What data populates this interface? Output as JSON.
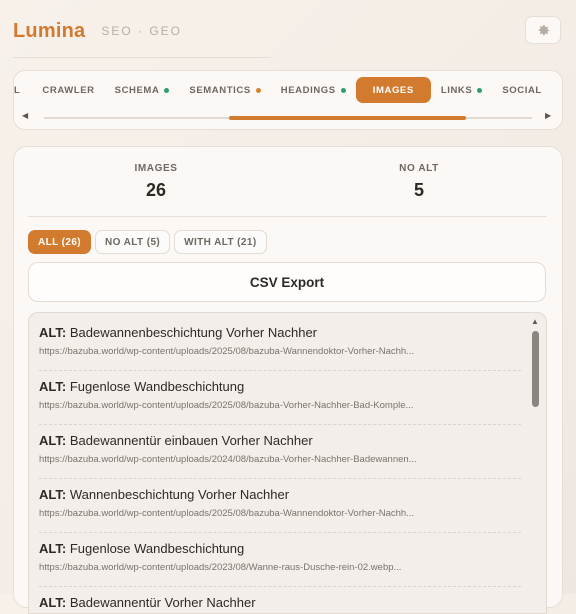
{
  "app": {
    "brand": "Lumina",
    "tagline": "SEO · GEO",
    "settings_icon": "gear-icon"
  },
  "tabs": [
    {
      "label": "L",
      "dot": null,
      "active": false
    },
    {
      "label": "CRAWLER",
      "dot": null,
      "active": false
    },
    {
      "label": "SCHEMA",
      "dot": "#2f9e6e",
      "active": false
    },
    {
      "label": "SEMANTICS",
      "dot": "#d9822b",
      "active": false
    },
    {
      "label": "HEADINGS",
      "dot": "#2f9e6e",
      "active": false
    },
    {
      "label": "IMAGES",
      "dot": null,
      "active": true
    },
    {
      "label": "LINKS",
      "dot": "#2f9e6e",
      "active": false
    },
    {
      "label": "SOCIAL",
      "dot": null,
      "active": false
    }
  ],
  "tab_scroll": {
    "left_arrow": "◀",
    "right_arrow": "▶"
  },
  "stats": {
    "images": {
      "label": "IMAGES",
      "value": "26"
    },
    "no_alt": {
      "label": "NO ALT",
      "value": "5"
    }
  },
  "filters": [
    {
      "label": "ALL (26)",
      "active": true
    },
    {
      "label": "NO ALT (5)",
      "active": false
    },
    {
      "label": "WITH ALT (21)",
      "active": false
    }
  ],
  "csv_button": "CSV Export",
  "alt_prefix": "ALT:",
  "images": [
    {
      "alt": "Badewannenbeschichtung Vorher Nachher",
      "url": "https://bazuba.world/wp-content/uploads/2025/08/bazuba-Wannendoktor-Vorher-Nachh..."
    },
    {
      "alt": "Fugenlose Wandbeschichtung",
      "url": "https://bazuba.world/wp-content/uploads/2025/08/bazuba-Vorher-Nachher-Bad-Komple..."
    },
    {
      "alt": "Badewannentür einbauen Vorher Nachher",
      "url": "https://bazuba.world/wp-content/uploads/2024/08/bazuba-Vorher-Nachher-Badewannen..."
    },
    {
      "alt": "Wannenbeschichtung Vorher Nachher",
      "url": "https://bazuba.world/wp-content/uploads/2025/08/bazuba-Wannendoktor-Vorher-Nachh..."
    },
    {
      "alt": "Fugenlose Wandbeschichtung",
      "url": "https://bazuba.world/wp-content/uploads/2023/08/Wanne-raus-Dusche-rein-02.webp..."
    },
    {
      "alt": "Badewannentür Vorher Nachher",
      "url": ""
    }
  ],
  "colors": {
    "accent": "#d27a2e",
    "ok": "#2f9e6e",
    "warn": "#d9822b"
  }
}
